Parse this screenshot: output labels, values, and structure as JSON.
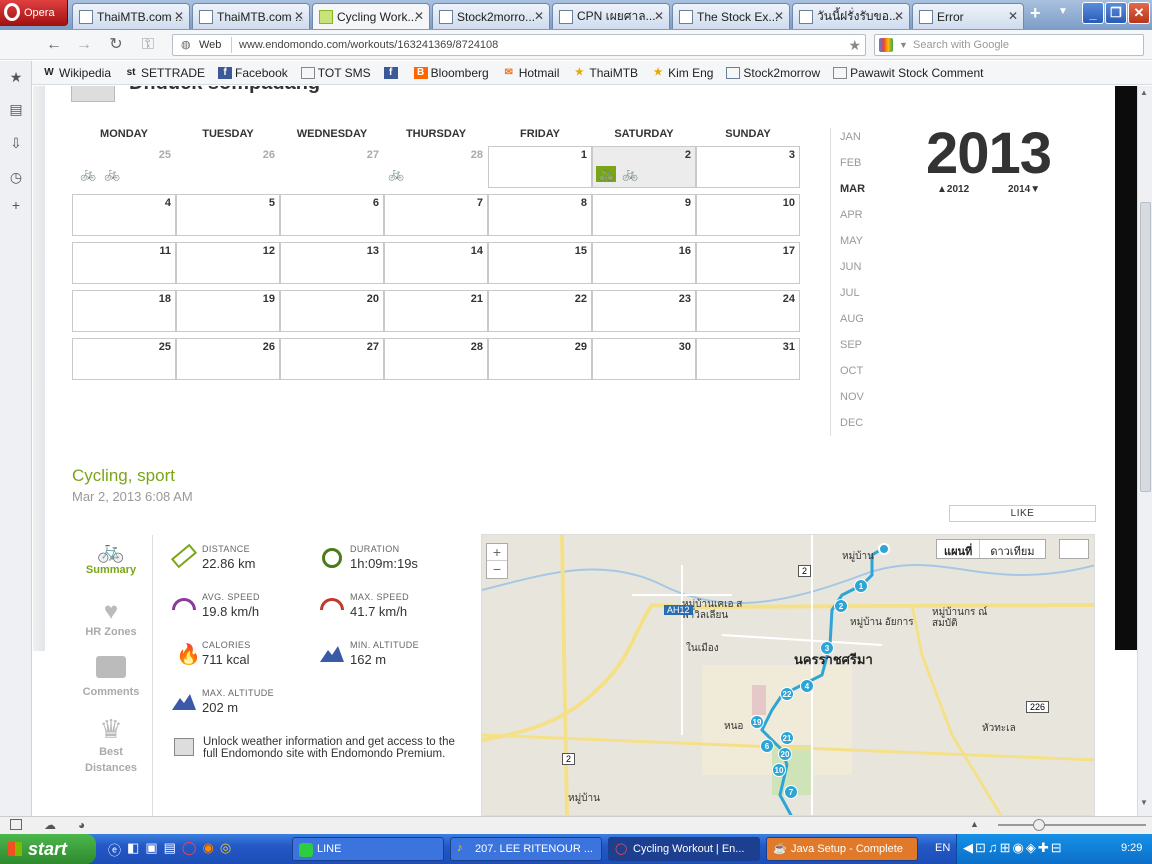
{
  "browser": {
    "opera_label": "Opera",
    "tabs": [
      {
        "label": "ThaiMTB.com ..."
      },
      {
        "label": "ThaiMTB.com ..."
      },
      {
        "label": "Cycling Work..."
      },
      {
        "label": "Stock2morro..."
      },
      {
        "label": "CPN เผยศาล..."
      },
      {
        "label": "The Stock Ex..."
      },
      {
        "label": "วันนี้ฝรั่งรับขอ..."
      },
      {
        "label": "Error"
      }
    ],
    "web_label": "Web",
    "url": "www.endomondo.com/workouts/163241369/8724108",
    "search_placeholder": "Search with Google",
    "bookmarks": [
      "Wikipedia",
      "SETTRADE",
      "Facebook",
      "TOT SMS",
      "",
      "Bloomberg",
      "Hotmail",
      "ThaiMTB",
      "Kim Eng",
      "Stock2morrow",
      "Pawawit Stock Comment"
    ]
  },
  "page": {
    "user_name": "Dr.duck sompadang",
    "calendar": {
      "weekdays": [
        "MONDAY",
        "TUESDAY",
        "WEDNESDAY",
        "THURSDAY",
        "FRIDAY",
        "SATURDAY",
        "SUNDAY"
      ],
      "week0": [
        "25",
        "26",
        "27",
        "28",
        "1",
        "2",
        "3"
      ],
      "week1": [
        "4",
        "5",
        "6",
        "7",
        "8",
        "9",
        "10"
      ],
      "week2": [
        "11",
        "12",
        "13",
        "14",
        "15",
        "16",
        "17"
      ],
      "week3": [
        "18",
        "19",
        "20",
        "21",
        "22",
        "23",
        "24"
      ],
      "week4": [
        "25",
        "26",
        "27",
        "28",
        "29",
        "30",
        "31"
      ],
      "months": [
        "JAN",
        "FEB",
        "MAR",
        "APR",
        "MAY",
        "JUN",
        "JUL",
        "AUG",
        "SEP",
        "OCT",
        "NOV",
        "DEC"
      ],
      "selected_month": "MAR",
      "year": "2013",
      "prev_year": "2012",
      "next_year": "2014"
    },
    "workout": {
      "title": "Cycling, sport",
      "date": "Mar 2, 2013 6:08 AM",
      "like_label": "LIKE",
      "nav": {
        "summary": "Summary",
        "hr_zones": "HR Zones",
        "comments": "Comments",
        "best_distances": "Best Distances"
      },
      "stats": {
        "distance_label": "DISTANCE",
        "distance": "22.86 km",
        "duration_label": "DURATION",
        "duration": "1h:09m:19s",
        "avg_speed_label": "AVG. SPEED",
        "avg_speed": "19.8 km/h",
        "max_speed_label": "MAX. SPEED",
        "max_speed": "41.7 km/h",
        "calories_label": "CALORIES",
        "calories": "711 kcal",
        "min_alt_label": "MIN. ALTITUDE",
        "min_alt": "162 m",
        "max_alt_label": "MAX. ALTITUDE",
        "max_alt": "202 m"
      },
      "premium_text": "Unlock weather information and get access to the full Endomondo site with Endomondo Premium.",
      "map": {
        "map_btn": "แผนที่",
        "sat_btn": "ดาวเทียม",
        "zoom_in": "+",
        "zoom_out": "−",
        "labels": [
          "หมู่บ้านเคเอ สพาวิลเลียน",
          "หมู่บ้าน อัยการ",
          "หมู่บ้านกร ณ์สมบัติ",
          "ในเมือง",
          "นครราชศรีมา",
          "หมู่บ้าน",
          "หัวทะเล",
          "หนอ",
          "หมู่บ้าน",
          "AH12",
          "2",
          "2",
          "226"
        ],
        "markers": [
          "1",
          "2",
          "3",
          "4",
          "22",
          "7",
          "6",
          "10",
          "19",
          "20",
          "21"
        ]
      }
    }
  },
  "taskbar": {
    "start_label": "start",
    "tasks": [
      "LINE",
      "207. LEE RITENOUR ...",
      "Cycling Workout | En...",
      "Java Setup - Complete"
    ],
    "lang": "EN",
    "time": "9:29"
  }
}
